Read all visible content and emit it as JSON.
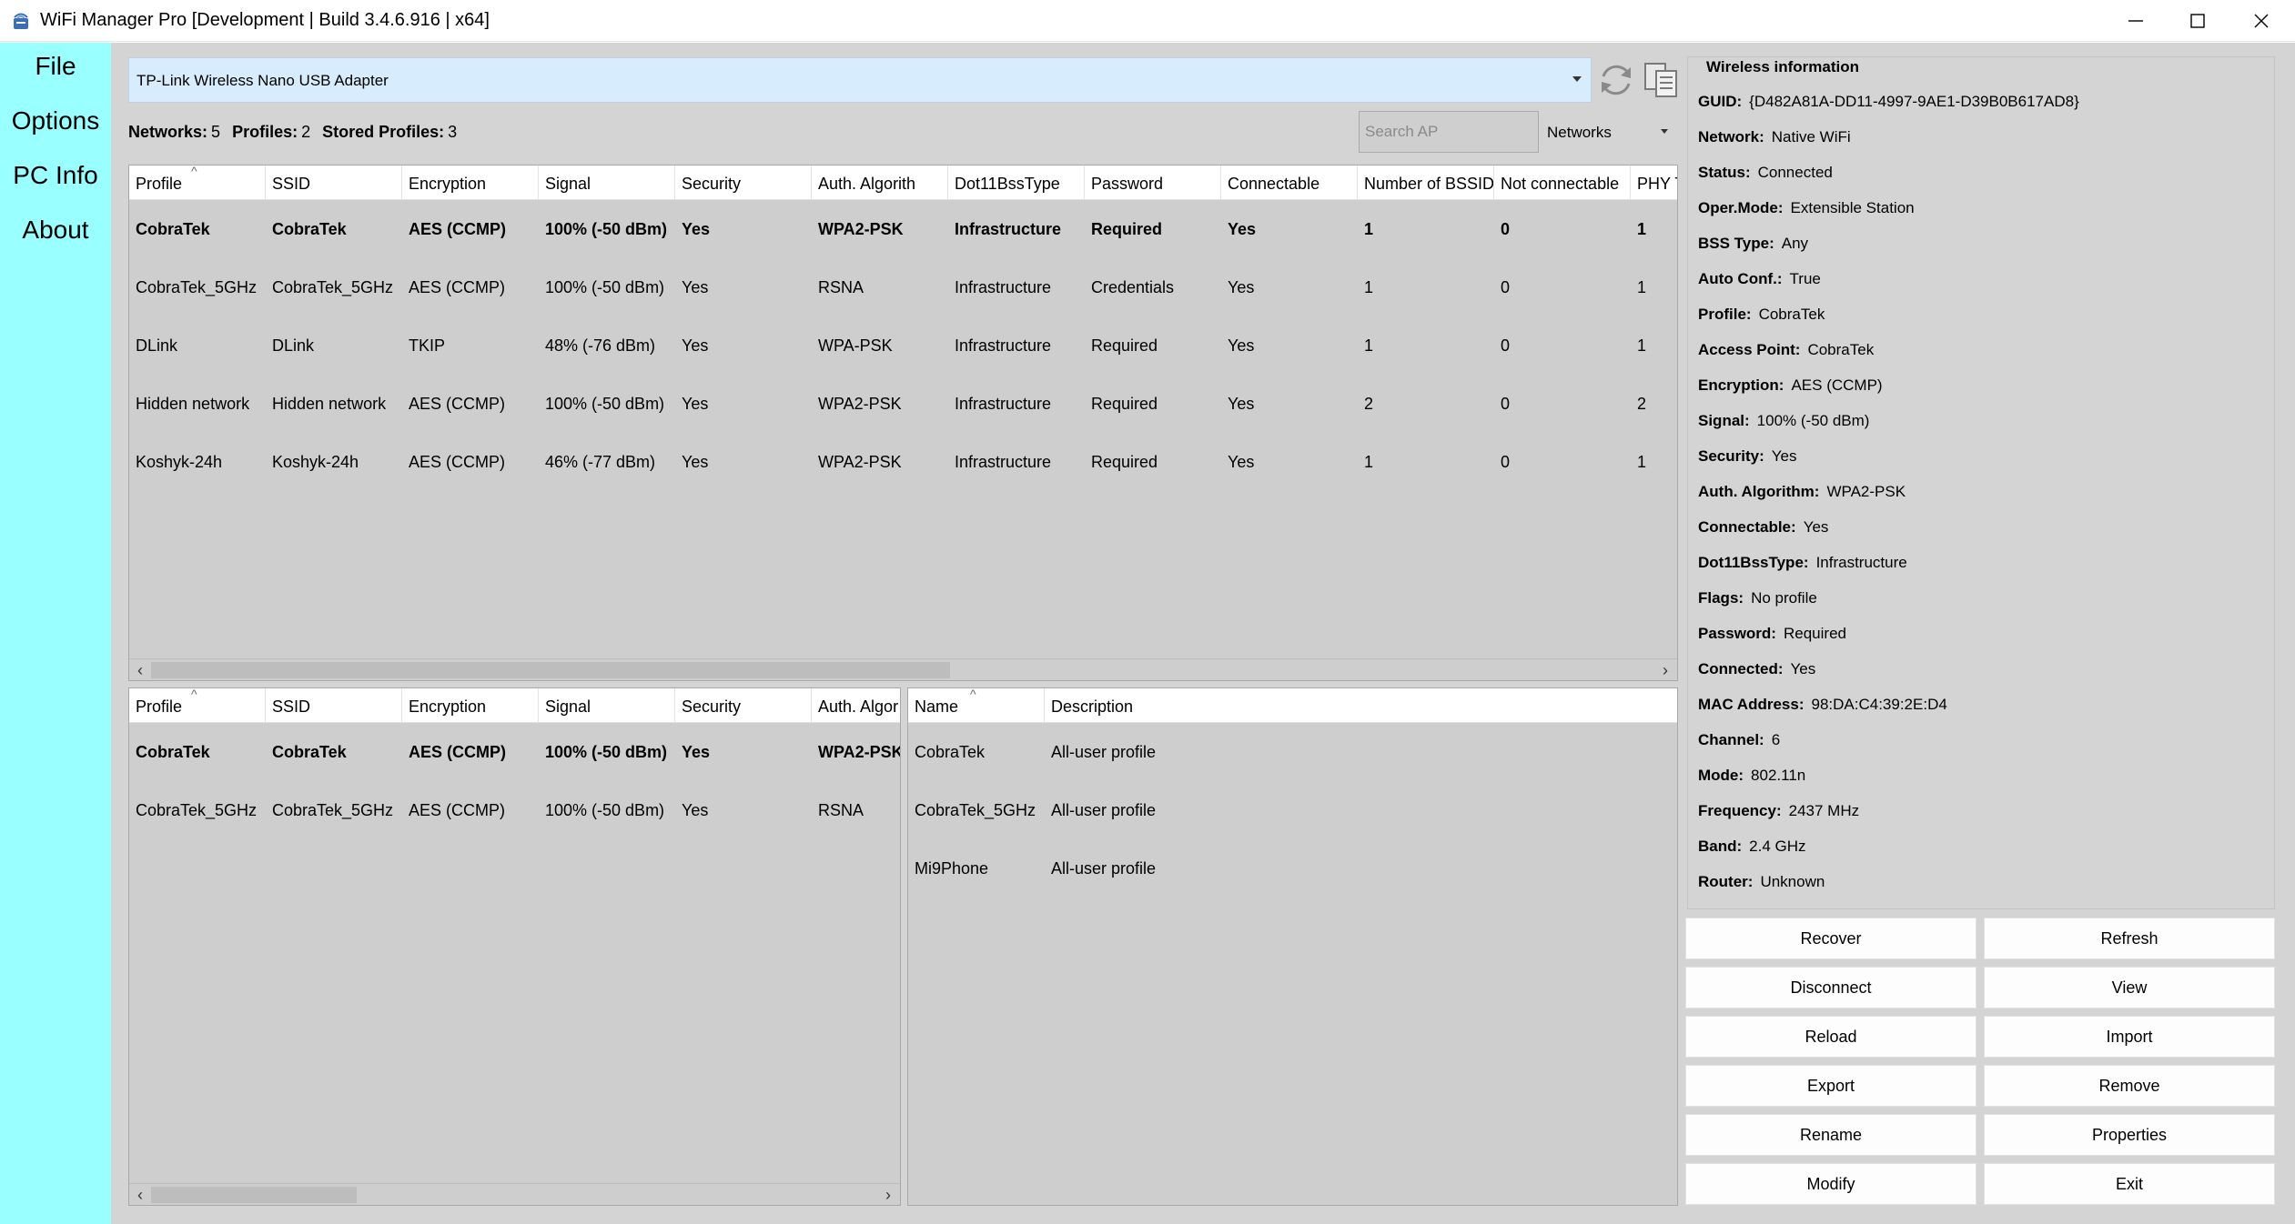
{
  "window": {
    "title": "WiFi Manager Pro [Development | Build 3.4.6.916 | x64]"
  },
  "menu": [
    "File",
    "Options",
    "PC Info",
    "About"
  ],
  "adapter": {
    "selected": "TP-Link Wireless Nano USB Adapter"
  },
  "counts": {
    "networks_label": "Networks:",
    "networks": "5",
    "profiles_label": "Profiles:",
    "profiles": "2",
    "stored_label": "Stored Profiles:",
    "stored": "3"
  },
  "search": {
    "placeholder": "Search AP"
  },
  "filter": {
    "selected": "Networks"
  },
  "networks_table": {
    "columns": [
      "Profile",
      "SSID",
      "Encryption",
      "Signal",
      "Security",
      "Auth. Algorith",
      "Dot11BssType",
      "Password",
      "Connectable",
      "Number of BSSID",
      "Not connectable",
      "PHY T"
    ],
    "rows": [
      [
        "CobraTek",
        "CobraTek",
        "AES (CCMP)",
        "100% (-50 dBm)",
        "Yes",
        "WPA2-PSK",
        "Infrastructure",
        "Required",
        "Yes",
        "1",
        "0",
        "1"
      ],
      [
        "CobraTek_5GHz",
        "CobraTek_5GHz",
        "AES (CCMP)",
        "100% (-50 dBm)",
        "Yes",
        "RSNA",
        "Infrastructure",
        "Credentials",
        "Yes",
        "1",
        "0",
        "1"
      ],
      [
        "DLink",
        "DLink",
        "TKIP",
        "48% (-76 dBm)",
        "Yes",
        "WPA-PSK",
        "Infrastructure",
        "Required",
        "Yes",
        "1",
        "0",
        "1"
      ],
      [
        "Hidden network",
        "Hidden network",
        "AES (CCMP)",
        "100% (-50 dBm)",
        "Yes",
        "WPA2-PSK",
        "Infrastructure",
        "Required",
        "Yes",
        "2",
        "0",
        "2"
      ],
      [
        "Koshyk-24h",
        "Koshyk-24h",
        "AES (CCMP)",
        "46% (-77 dBm)",
        "Yes",
        "WPA2-PSK",
        "Infrastructure",
        "Required",
        "Yes",
        "1",
        "0",
        "1"
      ]
    ]
  },
  "profiles_table": {
    "columns": [
      "Profile",
      "SSID",
      "Encryption",
      "Signal",
      "Security",
      "Auth. Algor"
    ],
    "rows": [
      [
        "CobraTek",
        "CobraTek",
        "AES (CCMP)",
        "100% (-50 dBm)",
        "Yes",
        "WPA2-PSK"
      ],
      [
        "CobraTek_5GHz",
        "CobraTek_5GHz",
        "AES (CCMP)",
        "100% (-50 dBm)",
        "Yes",
        "RSNA"
      ]
    ]
  },
  "stored_table": {
    "columns": [
      "Name",
      "Description"
    ],
    "rows": [
      [
        "CobraTek",
        "All-user profile"
      ],
      [
        "CobraTek_5GHz",
        "All-user profile"
      ],
      [
        "Mi9Phone",
        "All-user profile"
      ]
    ]
  },
  "wireless_info": {
    "title": "Wireless information",
    "fields": [
      {
        "label": "GUID:",
        "value": "{D482A81A-DD11-4997-9AE1-D39B0B617AD8}"
      },
      {
        "label": "Network:",
        "value": "Native WiFi"
      },
      {
        "label": "Status:",
        "value": "Connected"
      },
      {
        "label": "Oper.Mode:",
        "value": "Extensible Station"
      },
      {
        "label": "BSS Type:",
        "value": "Any"
      },
      {
        "label": "Auto Conf.:",
        "value": "True"
      },
      {
        "label": "Profile:",
        "value": "CobraTek"
      },
      {
        "label": "Access Point:",
        "value": "CobraTek"
      },
      {
        "label": "Encryption:",
        "value": "AES (CCMP)"
      },
      {
        "label": "Signal:",
        "value": "100% (-50 dBm)"
      },
      {
        "label": "Security:",
        "value": "Yes"
      },
      {
        "label": "Auth. Algorithm:",
        "value": "WPA2-PSK"
      },
      {
        "label": "Connectable:",
        "value": "Yes"
      },
      {
        "label": "Dot11BssType:",
        "value": "Infrastructure"
      },
      {
        "label": "Flags:",
        "value": "No profile"
      },
      {
        "label": "Password:",
        "value": "Required"
      },
      {
        "label": "Connected:",
        "value": "Yes"
      },
      {
        "label": "MAC Address:",
        "value": "98:DA:C4:39:2E:D4"
      },
      {
        "label": "Channel:",
        "value": "6"
      },
      {
        "label": "Mode:",
        "value": "802.11n"
      },
      {
        "label": "Frequency:",
        "value": "2437 MHz"
      },
      {
        "label": "Band:",
        "value": "2.4 GHz"
      },
      {
        "label": "Router:",
        "value": "Unknown"
      }
    ]
  },
  "actions": [
    "Recover",
    "Refresh",
    "Disconnect",
    "View",
    "Reload",
    "Import",
    "Export",
    "Remove",
    "Rename",
    "Properties",
    "Modify",
    "Exit"
  ],
  "colors": {
    "menu_bg": "#99ffff",
    "main_bg": "#d4d4d4",
    "list_bg": "#cecece",
    "adapter_bg": "#d7ecfd"
  },
  "icons": [
    "wifi-app-icon",
    "refresh-icon",
    "copy-icon",
    "minimize-icon",
    "maximize-icon",
    "close-icon",
    "sort-up-icon",
    "chevron-down-icon"
  ]
}
